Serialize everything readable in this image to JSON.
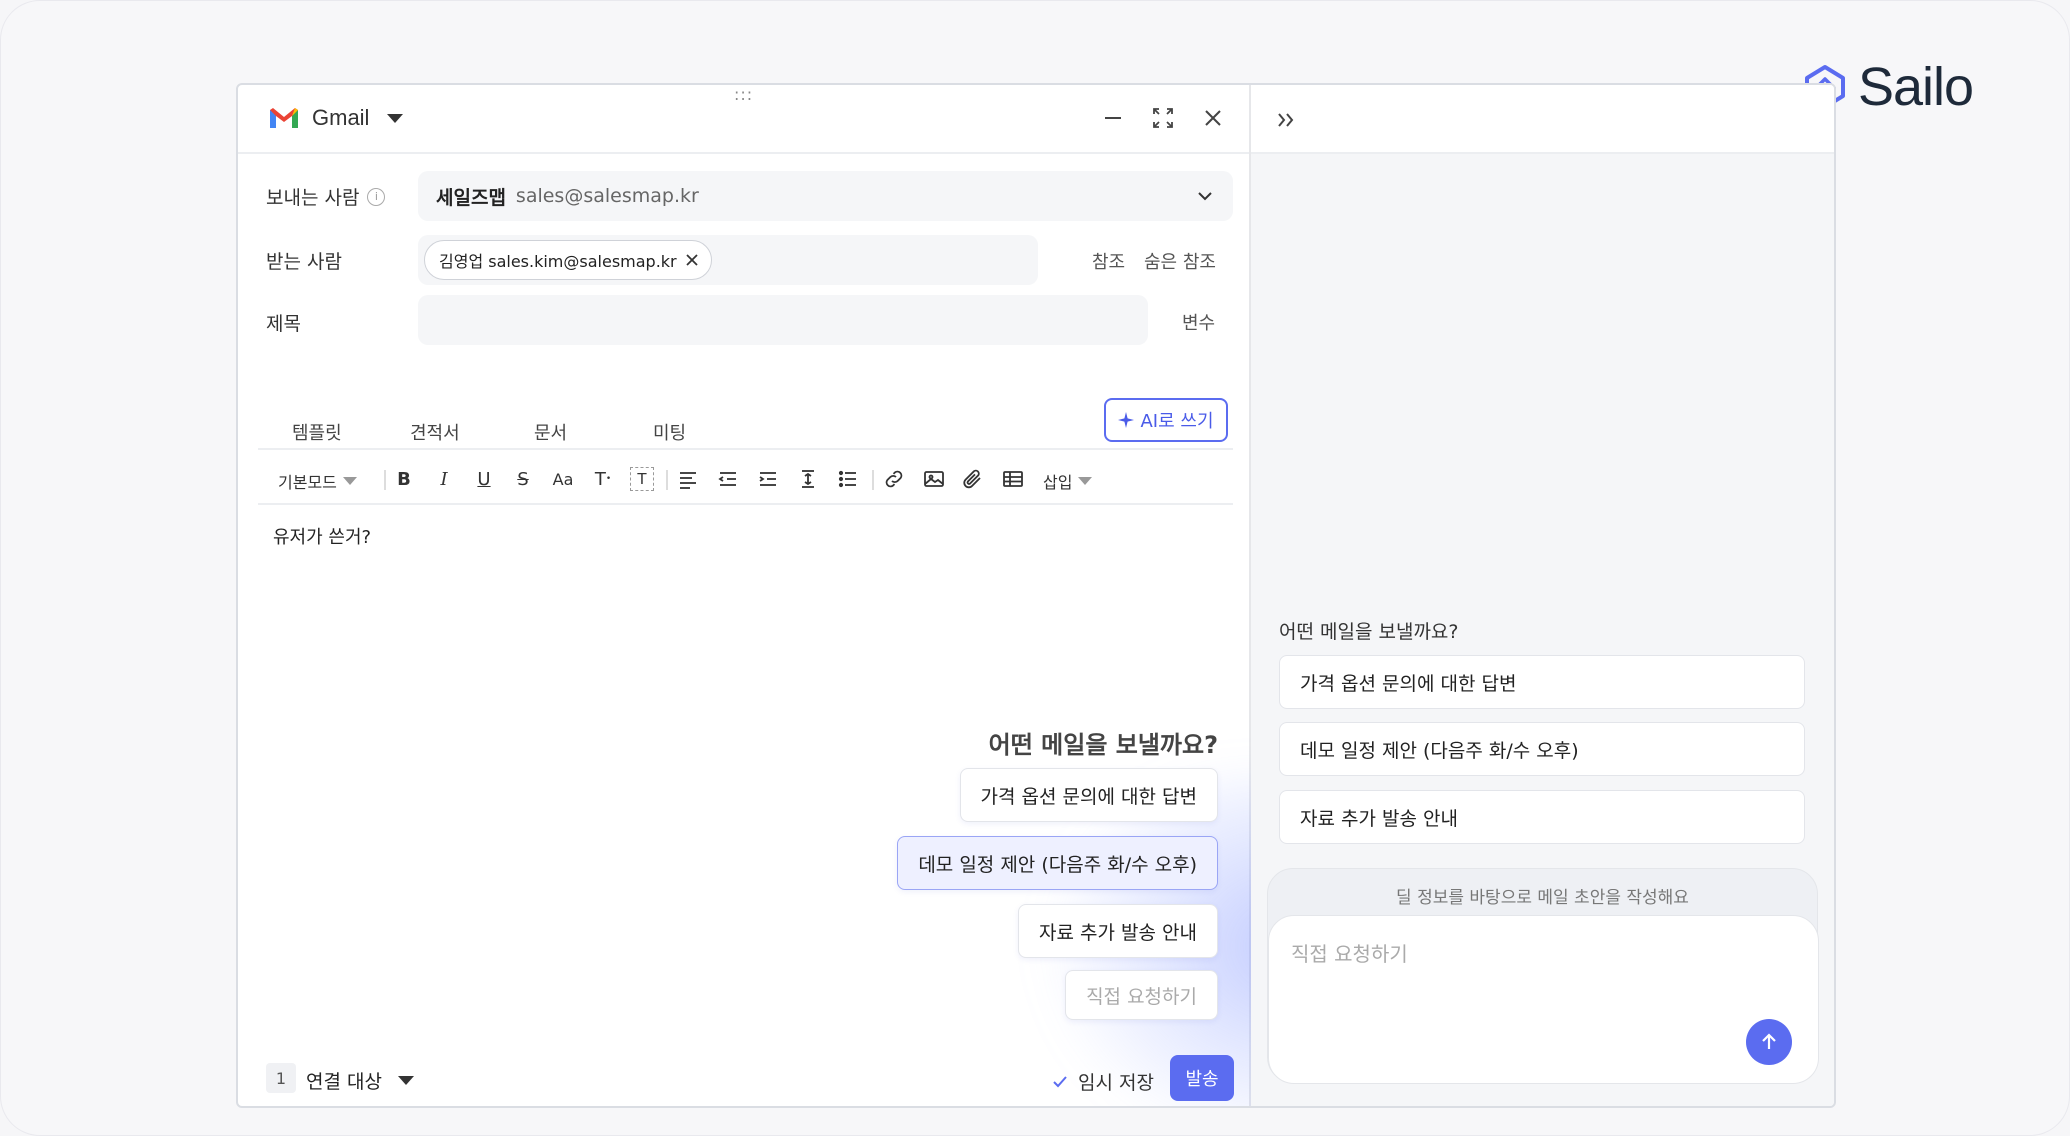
{
  "brand": {
    "name": "Sailo"
  },
  "window": {
    "app_label": "Gmail",
    "drag_handle": ":::"
  },
  "fields": {
    "sender_label": "보내는 사람",
    "sender_name": "세일즈맵",
    "sender_email": "sales@salesmap.kr",
    "to_label": "받는 사람",
    "to_chip": "김영업 sales.kim@salesmap.kr",
    "cc_label": "참조",
    "bcc_label": "숨은 참조",
    "subject_label": "제목",
    "subject_value": "",
    "variable_label": "변수"
  },
  "tabs": [
    "템플릿",
    "견적서",
    "문서",
    "미팅"
  ],
  "ai_button": "AI로 쓰기",
  "toolbar": {
    "mode": "기본모드",
    "insert": "삽입"
  },
  "editor": {
    "text": "유저가 쓴거?"
  },
  "suggestions": {
    "title": "어떤 메일을 보낼까요?",
    "items": [
      "가격 옵션 문의에 대한 답변",
      "데모 일정 제안 (다음주 화/수 오후)",
      "자료 추가 발송 안내"
    ],
    "custom_placeholder": "직접 요청하기"
  },
  "bottom": {
    "count": "1",
    "connect_label": "연결 대상",
    "draft_label": "임시 저장",
    "send_label": "발송"
  },
  "panel": {
    "title": "어떤 메일을 보낼까요?",
    "options": [
      "가격 옵션 문의에 대한 답변",
      "데모 일정 제안 (다음주 화/수 오후)",
      "자료 추가 발송 안내"
    ],
    "hint": "딜 정보를 바탕으로 메일 초안을 작성해요",
    "input_placeholder": "직접 요청하기"
  },
  "colors": {
    "accent": "#5b6cf0",
    "brand_dark": "#1e2a3a",
    "gmail_red": "#ea4335"
  }
}
